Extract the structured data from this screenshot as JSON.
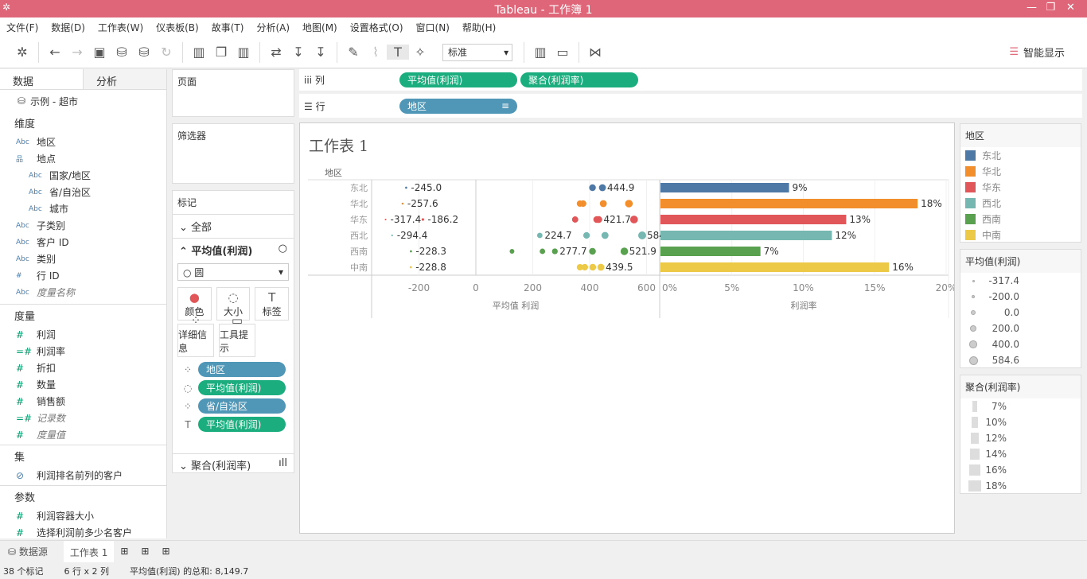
{
  "window": {
    "title": "Tableau - 工作簿 1"
  },
  "menu": [
    "文件(F)",
    "数据(D)",
    "工作表(W)",
    "仪表板(B)",
    "故事(T)",
    "分析(A)",
    "地图(M)",
    "设置格式(O)",
    "窗口(N)",
    "帮助(H)"
  ],
  "toolbar": {
    "fit_select": "标准",
    "show_me": "智能显示"
  },
  "left": {
    "tab_data": "数据",
    "tab_analysis": "分析",
    "datasource": "示例 - 超市",
    "dimensions_title": "维度",
    "dimensions": [
      {
        "t": "Abc",
        "n": "地区",
        "lv": 0
      },
      {
        "t": "品",
        "n": "地点",
        "lv": 0
      },
      {
        "t": "Abc",
        "n": "国家/地区",
        "lv": 1
      },
      {
        "t": "Abc",
        "n": "省/自治区",
        "lv": 1
      },
      {
        "t": "Abc",
        "n": "城市",
        "lv": 1
      },
      {
        "t": "Abc",
        "n": "子类别",
        "lv": 0
      },
      {
        "t": "Abc",
        "n": "客户 ID",
        "lv": 0
      },
      {
        "t": "Abc",
        "n": "类别",
        "lv": 0
      },
      {
        "t": "#",
        "n": "行 ID",
        "lv": 0
      },
      {
        "t": "Abc",
        "n": "度量名称",
        "lv": 0,
        "i": true
      }
    ],
    "measures_title": "度量",
    "measures": [
      {
        "t": "#",
        "n": "利润"
      },
      {
        "t": "=#",
        "n": "利润率"
      },
      {
        "t": "#",
        "n": "折扣"
      },
      {
        "t": "#",
        "n": "数量"
      },
      {
        "t": "#",
        "n": "销售额"
      },
      {
        "t": "=#",
        "n": "记录数",
        "i": true
      },
      {
        "t": "#",
        "n": "度量值",
        "i": true
      }
    ],
    "sets_title": "集",
    "sets": [
      "利润排名前列的客户"
    ],
    "params_title": "参数",
    "params": [
      "利润容器大小",
      "选择利润前多少名客户"
    ]
  },
  "shelves": {
    "pages": "页面",
    "filters": "筛选器",
    "marks": "标记",
    "all": "全部",
    "avg_card": "平均值(利润)",
    "mark_type": "圆",
    "buttons": [
      "颜色",
      "大小",
      "标签",
      "详细信息",
      "工具提示"
    ],
    "mark_pills": [
      "地区",
      "平均值(利润)",
      "省/自治区",
      "平均值(利润)"
    ],
    "agg_card": "聚合(利润率)",
    "columns_label": "列",
    "rows_label": "行",
    "col_pills": [
      "平均值(利润)",
      "聚合(利润率)"
    ],
    "row_pills": [
      "地区"
    ]
  },
  "sheet": {
    "title": "工作表 1",
    "row_header": "地区"
  },
  "chart_data": {
    "type": "scatter",
    "categories": [
      "东北",
      "华北",
      "华东",
      "西北",
      "西南",
      "中南"
    ],
    "colors": [
      "#4e79a7",
      "#f28e2b",
      "#e15759",
      "#76b7b2",
      "#59a14f",
      "#edc948"
    ],
    "dots": {
      "x_label": "平均值 利润",
      "xlim": [
        -330,
        620
      ],
      "ticks": [
        "-200",
        "0",
        "200",
        "400",
        "600"
      ],
      "tick_values": [
        -200,
        0,
        200,
        400,
        600
      ],
      "points": [
        [
          -245.0,
          410,
          444.9
        ],
        [
          -257.6,
          366,
          377,
          448,
          538
        ],
        [
          -317.4,
          -186.2,
          349,
          425,
          432,
          556
        ],
        [
          -294.4,
          224.7,
          389,
          454,
          584.6
        ],
        [
          -228.3,
          127,
          234,
          277.7,
          410,
          521.9
        ],
        [
          -228.8,
          366,
          383,
          411,
          439.5
        ]
      ],
      "labels": [
        [
          "-245.0",
          "444.9"
        ],
        [
          "-257.6"
        ],
        [
          "-317.4",
          "-186.2",
          "421.7"
        ],
        [
          "-294.4",
          "224.7",
          "584.6"
        ],
        [
          "-228.3",
          "277.7",
          "521.9"
        ],
        [
          "-228.8",
          "439.5"
        ]
      ],
      "label_values": [
        [
          -245.0,
          444.9
        ],
        [
          -257.6
        ],
        [
          -317.4,
          -186.2,
          432
        ],
        [
          -294.4,
          224.7,
          584.6
        ],
        [
          -228.3,
          277.7,
          521.9
        ],
        [
          -228.8,
          439.5
        ]
      ]
    },
    "bars": {
      "type": "bar",
      "x_label": "利润率",
      "xlim": [
        0,
        20
      ],
      "ticks": [
        "0%",
        "5%",
        "10%",
        "15%",
        "20%"
      ],
      "tick_values": [
        0,
        5,
        10,
        15,
        20
      ],
      "values": [
        9,
        18,
        13,
        12,
        7,
        16
      ],
      "labels": [
        "9%",
        "18%",
        "13%",
        "12%",
        "7%",
        "16%"
      ]
    }
  },
  "legends": {
    "color_title": "地区",
    "color_items": [
      "东北",
      "华北",
      "华东",
      "西北",
      "西南",
      "中南"
    ],
    "size_title": "平均值(利润)",
    "size_items": [
      "-317.4",
      "-200.0",
      "0.0",
      "200.0",
      "400.0",
      "584.6"
    ],
    "bar_title": "聚合(利润率)",
    "bar_items": [
      "7%",
      "10%",
      "12%",
      "14%",
      "16%",
      "18%"
    ]
  },
  "tabs": {
    "datasource": "数据源",
    "sheet": "工作表 1"
  },
  "status": {
    "marks": "38 个标记",
    "dims": "6 行 x 2 列",
    "sum": "平均值(利润) 的总和: 8,149.7"
  }
}
